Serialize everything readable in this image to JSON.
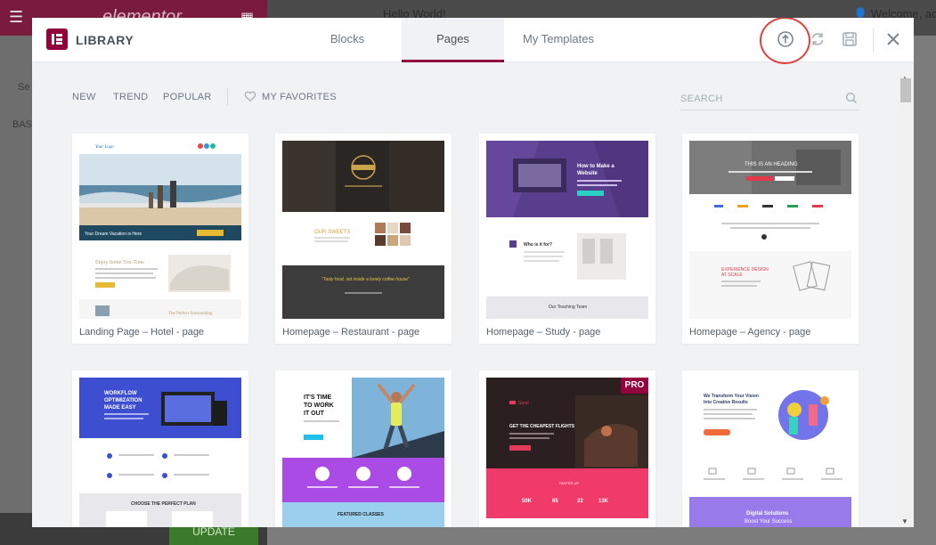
{
  "background": {
    "page_title": "Hello World!",
    "user_greeting": "Welcome, adm",
    "panel_search": "Se",
    "panel_section": "BAS",
    "update_label": "UPDATE",
    "logo_text": "elementor"
  },
  "header": {
    "logo_label": "LIBRARY",
    "tabs": [
      {
        "label": "Blocks",
        "active": false
      },
      {
        "label": "Pages",
        "active": true
      },
      {
        "label": "My Templates",
        "active": false
      }
    ],
    "icons": [
      "import-icon",
      "sync-icon",
      "save-icon",
      "close-icon"
    ]
  },
  "toolbar": {
    "filters": [
      "NEW",
      "TREND",
      "POPULAR"
    ],
    "favorites_label": "MY FAVORITES",
    "search_placeholder": "SEARCH"
  },
  "templates": [
    {
      "title": "Landing Page – Hotel - page",
      "pro": false
    },
    {
      "title": "Homepage – Restaurant - page",
      "pro": false
    },
    {
      "title": "Homepage – Study - page",
      "pro": false
    },
    {
      "title": "Homepage – Agency - page",
      "pro": false
    },
    {
      "title": "",
      "pro": false
    },
    {
      "title": "",
      "pro": false
    },
    {
      "title": "",
      "pro": true,
      "badge": "PRO"
    },
    {
      "title": "",
      "pro": false
    }
  ],
  "thumb_text": {
    "hotel_hero": "Your Dream Vacation is Here",
    "hotel_section": "Enjoy Some You-Time",
    "hotel_footer": "The Perfect Surrounding",
    "restaurant_section": "OUR SWEETS",
    "restaurant_quote": "\"Tasty food, set inside a lovely coffee house\"",
    "study_hero_1": "How to Make a",
    "study_hero_2": "Website",
    "study_section": "Who is it for?",
    "study_footer": "Our Teaching Team",
    "agency_hero": "THIS IS AN HEADING",
    "agency_section_1": "EXPERIENCE DESIGN",
    "agency_section_2": "AT SCALE",
    "workflow_1": "WORKFLOW",
    "workflow_2": "OPTIMIZATION",
    "workflow_3": "MADE EASY",
    "workflow_plan": "CHOOSE THE PERFECT PLAN",
    "fitness_1": "IT'S TIME",
    "fitness_2": "TO WORK",
    "fitness_3": "IT OUT",
    "fitness_classes": "FEATURED CLASSES",
    "travel_logo": "Sorel",
    "travel_hero": "GET THE CHEAPEST FLIGHTS",
    "travel_sub": "FASTER UP",
    "travel_stat_1": "50K",
    "travel_stat_2": "65",
    "travel_stat_3": "22",
    "travel_stat_4": "13K",
    "creative_1": "We Transform Your Vision",
    "creative_2": "Into Creative Results",
    "creative_3": "Digital Solutions",
    "creative_4": "Boost Your Success"
  },
  "colors": {
    "brand": "#92003b",
    "highlight_ring": "#e0403c",
    "accent_text": "#495157",
    "muted_text": "#6d7882"
  }
}
